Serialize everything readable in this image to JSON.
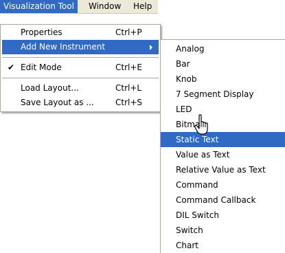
{
  "menubar": {
    "items": [
      {
        "label": "Visualization Tool"
      },
      {
        "label": "Window"
      },
      {
        "label": "Help"
      }
    ]
  },
  "primary_menu": {
    "items": [
      {
        "label": "Properties",
        "shortcut": "Ctrl+P"
      },
      {
        "label": "Add New Instrument",
        "has_submenu": true
      },
      {
        "label": "Edit Mode",
        "shortcut": "Ctrl+E",
        "checked": true,
        "check_glyph": "✔"
      },
      {
        "label": "Load Layout...",
        "shortcut": "Ctrl+L"
      },
      {
        "label": "Save Layout as ...",
        "shortcut": "Ctrl+S"
      }
    ]
  },
  "submenu": {
    "items": [
      {
        "label": "Analog"
      },
      {
        "label": "Bar"
      },
      {
        "label": "Knob"
      },
      {
        "label": "7 Segment Display"
      },
      {
        "label": "LED"
      },
      {
        "label": "Bitmap"
      },
      {
        "label": "Static Text"
      },
      {
        "label": "Value as Text"
      },
      {
        "label": "Relative Value as Text"
      },
      {
        "label": "Command"
      },
      {
        "label": "Command Callback"
      },
      {
        "label": "DIL Switch"
      },
      {
        "label": "Switch"
      },
      {
        "label": "Chart"
      }
    ]
  },
  "colors": {
    "highlight": "#316ac5",
    "menubar_bg": "#ece9d8",
    "menu_bg": "#ffffff",
    "border": "#aca899"
  },
  "icons": {
    "check": "check-icon",
    "submenu_arrow": "chevron-right-icon",
    "cursor": "hand-pointer-cursor-icon"
  }
}
